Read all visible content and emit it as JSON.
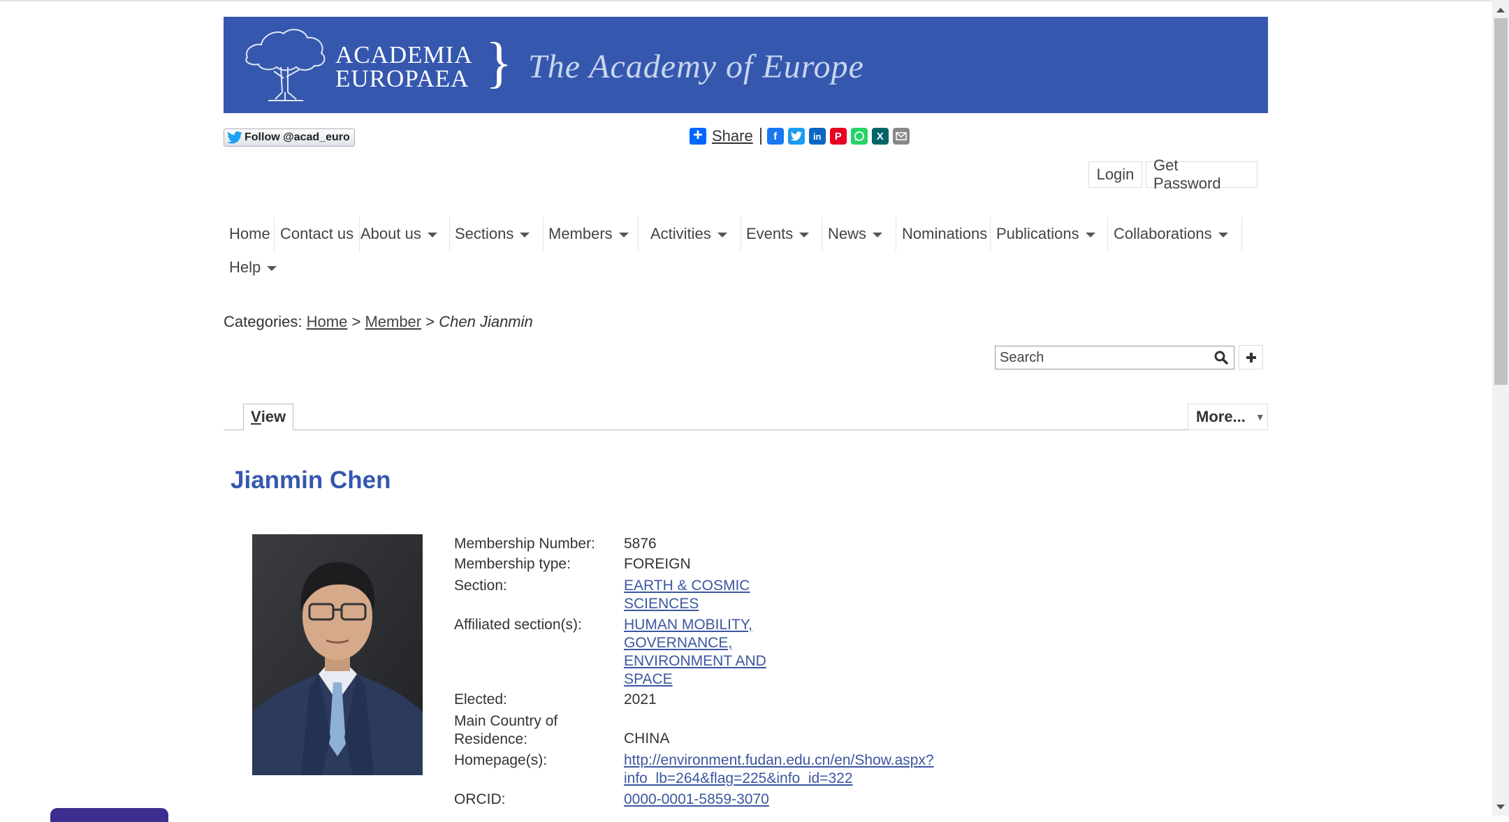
{
  "banner": {
    "brand_line1": "ACADEMIA",
    "brand_line2": "EUROPAEA",
    "brace": "}",
    "tagline": "The Academy of Europe",
    "bg_color": "#3558ae"
  },
  "social": {
    "follow_label": "Follow @acad_euro",
    "share_label": "Share",
    "share_icons": [
      "facebook-icon",
      "twitter-icon",
      "linkedin-icon",
      "pinterest-icon",
      "whatsapp-icon",
      "xing-icon",
      "email-icon"
    ]
  },
  "auth": {
    "login": "Login",
    "get_password": "Get Password"
  },
  "nav": {
    "items": [
      {
        "label": "Home",
        "dropdown": false
      },
      {
        "label": "Contact us",
        "dropdown": false
      },
      {
        "label": "About us",
        "dropdown": true
      },
      {
        "label": "Sections",
        "dropdown": true
      },
      {
        "label": "Members",
        "dropdown": true
      },
      {
        "label": "Activities",
        "dropdown": true
      },
      {
        "label": "Events",
        "dropdown": true
      },
      {
        "label": "News",
        "dropdown": true
      },
      {
        "label": "Nominations",
        "dropdown": false
      },
      {
        "label": "Publications",
        "dropdown": true
      },
      {
        "label": "Collaborations",
        "dropdown": true
      },
      {
        "label": "Help",
        "dropdown": true
      }
    ]
  },
  "breadcrumb": {
    "prefix": "Categories:",
    "home": "Home",
    "sep": ">",
    "member": "Member",
    "current": "Chen Jianmin"
  },
  "search": {
    "placeholder": "Search"
  },
  "tabs": {
    "view_first": "V",
    "view_rest": "iew",
    "more": "More...",
    "more_arrow": "▼"
  },
  "profile": {
    "name": "Jianmin Chen",
    "fields": {
      "membership_number_label": "Membership Number:",
      "membership_number": "5876",
      "membership_type_label": "Membership type:",
      "membership_type": "FOREIGN",
      "section_label": "Section:",
      "section_line1": "EARTH & COSMIC",
      "section_line2": "SCIENCES",
      "affiliated_label": "Affiliated section(s):",
      "affiliated_line1": "HUMAN MOBILITY,",
      "affiliated_line2": "GOVERNANCE,",
      "affiliated_line3": "ENVIRONMENT AND",
      "affiliated_line4": "SPACE",
      "elected_label": "Elected:",
      "elected": "2021",
      "country_label_line1": "Main Country of",
      "country_label_line2": "Residence:",
      "country": "CHINA",
      "homepage_label": "Homepage(s):",
      "homepage_line1": "http://environment.fudan.edu.cn/en/Show.aspx?",
      "homepage_line2": "info_lb=264&flag=225&info_id=322",
      "orcid_label": "ORCID:",
      "orcid": "0000-0001-5859-3070"
    }
  },
  "colors": {
    "accent": "#3558ae",
    "link": "#3b57a0"
  }
}
